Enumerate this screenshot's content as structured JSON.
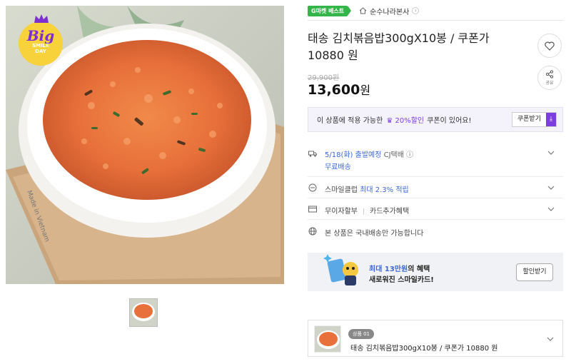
{
  "badge": {
    "big": "Big",
    "sub1": "SMILE",
    "sub2": "DAY"
  },
  "photo": {
    "plate_text": "Made in Vietnam",
    "alt": "food-photo"
  },
  "header": {
    "gmarket_badge": "G마켓 베스트",
    "shop_name": "순수나라본사"
  },
  "product": {
    "title_line1": "태송 김치볶음밥300gX10봉 / 쿠폰가",
    "title_line2": "10880 원",
    "original_price": "29,900원",
    "price": "13,600",
    "price_unit": "원",
    "share_label": "공유"
  },
  "coupon": {
    "prefix": "이 상품에 적용 가능한",
    "highlight": "♛ 20%할인",
    "suffix": "쿠폰이 있어요!",
    "button": "쿠폰받기",
    "button_icon": "⤓"
  },
  "shipping": {
    "date": "5/18(화) 출발예정",
    "carrier": "CJ택배",
    "fee": "무료배송"
  },
  "smileclub": {
    "label": "스마일클럽",
    "benefit": "최대 2.3% 적립"
  },
  "card": {
    "label1": "무이자할부",
    "label2": "카드추가혜택"
  },
  "domestic": {
    "text": "본 상품은 국내배송만 가능합니다"
  },
  "banner": {
    "line1_colored": "최대 13만원",
    "line1_rest": "의 혜택",
    "line2": "새로워진 스마일카드!",
    "button": "할인받기"
  },
  "option": {
    "tag": "상품 01",
    "name": "태송 김치볶음밥300gX10봉 / 쿠폰가 10880 원"
  },
  "colors": {
    "accent": "#7d3ee0",
    "link_blue": "#3c68d8",
    "gmarket_green": "#33b54a",
    "badge_yellow": "#f8d23a"
  }
}
